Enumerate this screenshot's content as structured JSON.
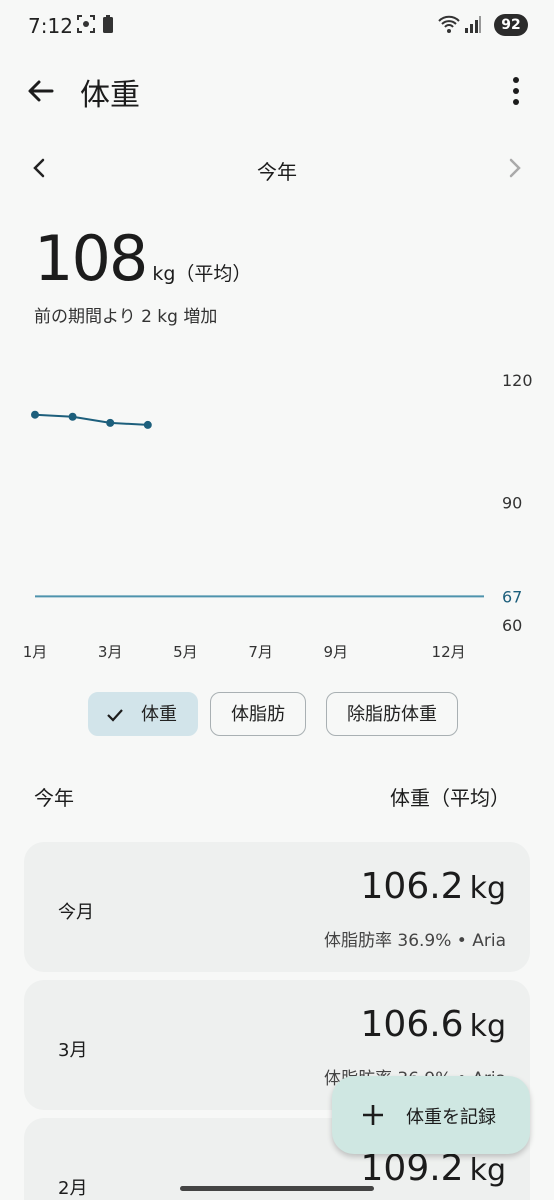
{
  "status": {
    "time": "7:12",
    "battery": "92"
  },
  "appbar": {
    "title": "体重"
  },
  "period": {
    "label": "今年"
  },
  "summary": {
    "value": "108",
    "unit": "kg（平均）",
    "delta": "前の期間より 2 kg 増加"
  },
  "chart_data": {
    "type": "line",
    "x": [
      "1月",
      "2月",
      "3月",
      "4月"
    ],
    "values": [
      111.5,
      111,
      109.5,
      109
    ],
    "target": 67,
    "ylim": [
      60,
      120
    ],
    "yticks": [
      "120",
      "90",
      "67",
      "60"
    ],
    "xticks": [
      "1月",
      "3月",
      "5月",
      "7月",
      "9月",
      "12月"
    ]
  },
  "chips": [
    {
      "label": "体重",
      "selected": true
    },
    {
      "label": "体脂肪",
      "selected": false
    },
    {
      "label": "除脂肪体重",
      "selected": false
    }
  ],
  "list_header": {
    "left": "今年",
    "right": "体重（平均）"
  },
  "rows": [
    {
      "label": "今月",
      "value": "106.2",
      "unit": "kg",
      "sub": "体脂肪率 36.9% • Aria"
    },
    {
      "label": "3月",
      "value": "106.6",
      "unit": "kg",
      "sub": "体脂肪率 36.9% • Aria"
    },
    {
      "label": "2月",
      "value": "109.2",
      "unit": "kg"
    }
  ],
  "fab": {
    "label": "体重を記録"
  },
  "colors": {
    "accent": "#1d5f7c",
    "target_line": "#4e93ad"
  }
}
